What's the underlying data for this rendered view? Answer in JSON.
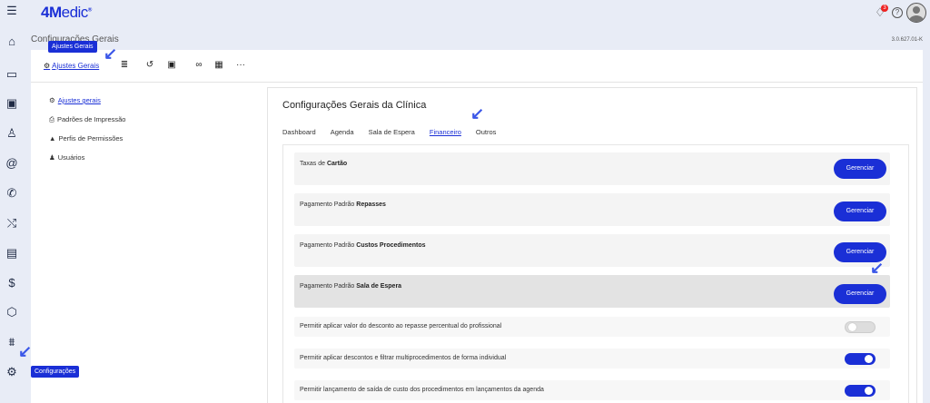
{
  "header": {
    "logo_bold": "4M",
    "logo_rest": "edic",
    "logo_reg": "®",
    "notif_count": "3",
    "help": "?"
  },
  "page": {
    "title": "Configurações Gerais",
    "version": "3.0.627.01-K"
  },
  "tooltips": {
    "toolbar": "Ajustes Gerais",
    "sidebar": "Configurações"
  },
  "left_icons": [
    "menu-icon",
    "home-icon",
    "calendar-icon",
    "inbox-icon",
    "user-icon",
    "at-icon",
    "phone-icon",
    "shuffle-icon",
    "clipboard-icon",
    "dollar-icon",
    "box-icon",
    "chart-icon",
    "gear-icon"
  ],
  "toolbar": {
    "active_label": "Ajustes Gerais",
    "more": "···"
  },
  "side_menu": [
    {
      "label": "Ajustes gerais",
      "icon": "gears-icon",
      "active": true
    },
    {
      "label": "Padrões de Impressão",
      "icon": "printer-icon",
      "active": false
    },
    {
      "label": "Perfis de Permissões",
      "icon": "lock-icon",
      "active": false
    },
    {
      "label": "Usuários",
      "icon": "users-icon",
      "active": false
    }
  ],
  "content": {
    "title": "Configurações Gerais da Clínica",
    "tabs": [
      "Dashboard",
      "Agenda",
      "Sala de Espera",
      "Financeiro",
      "Outros"
    ],
    "active_tab": "Financeiro"
  },
  "rows": [
    {
      "prefix": "Taxas de ",
      "bold": "Cartão",
      "button": "Gerenciar"
    },
    {
      "prefix": "Pagamento Padrão ",
      "bold": "Repasses",
      "button": "Gerenciar"
    },
    {
      "prefix": "Pagamento Padrão ",
      "bold": "Custos Procedimentos",
      "button": "Gerenciar"
    },
    {
      "prefix": "Pagamento Padrão ",
      "bold": "Sala de Espera",
      "button": "Gerenciar"
    }
  ],
  "toggles": [
    {
      "label": "Permitir aplicar valor do desconto ao repasse percentual do profissional",
      "on": false
    },
    {
      "label": "Permitir aplicar descontos e filtrar multiprocedimentos de forma individual",
      "on": true
    },
    {
      "label": "Permitir lançamento de saída de custo dos procedimentos em lançamentos da agenda",
      "on": true
    }
  ],
  "colors": {
    "accent": "#1a2fd6",
    "background": "#e8ecf6"
  }
}
